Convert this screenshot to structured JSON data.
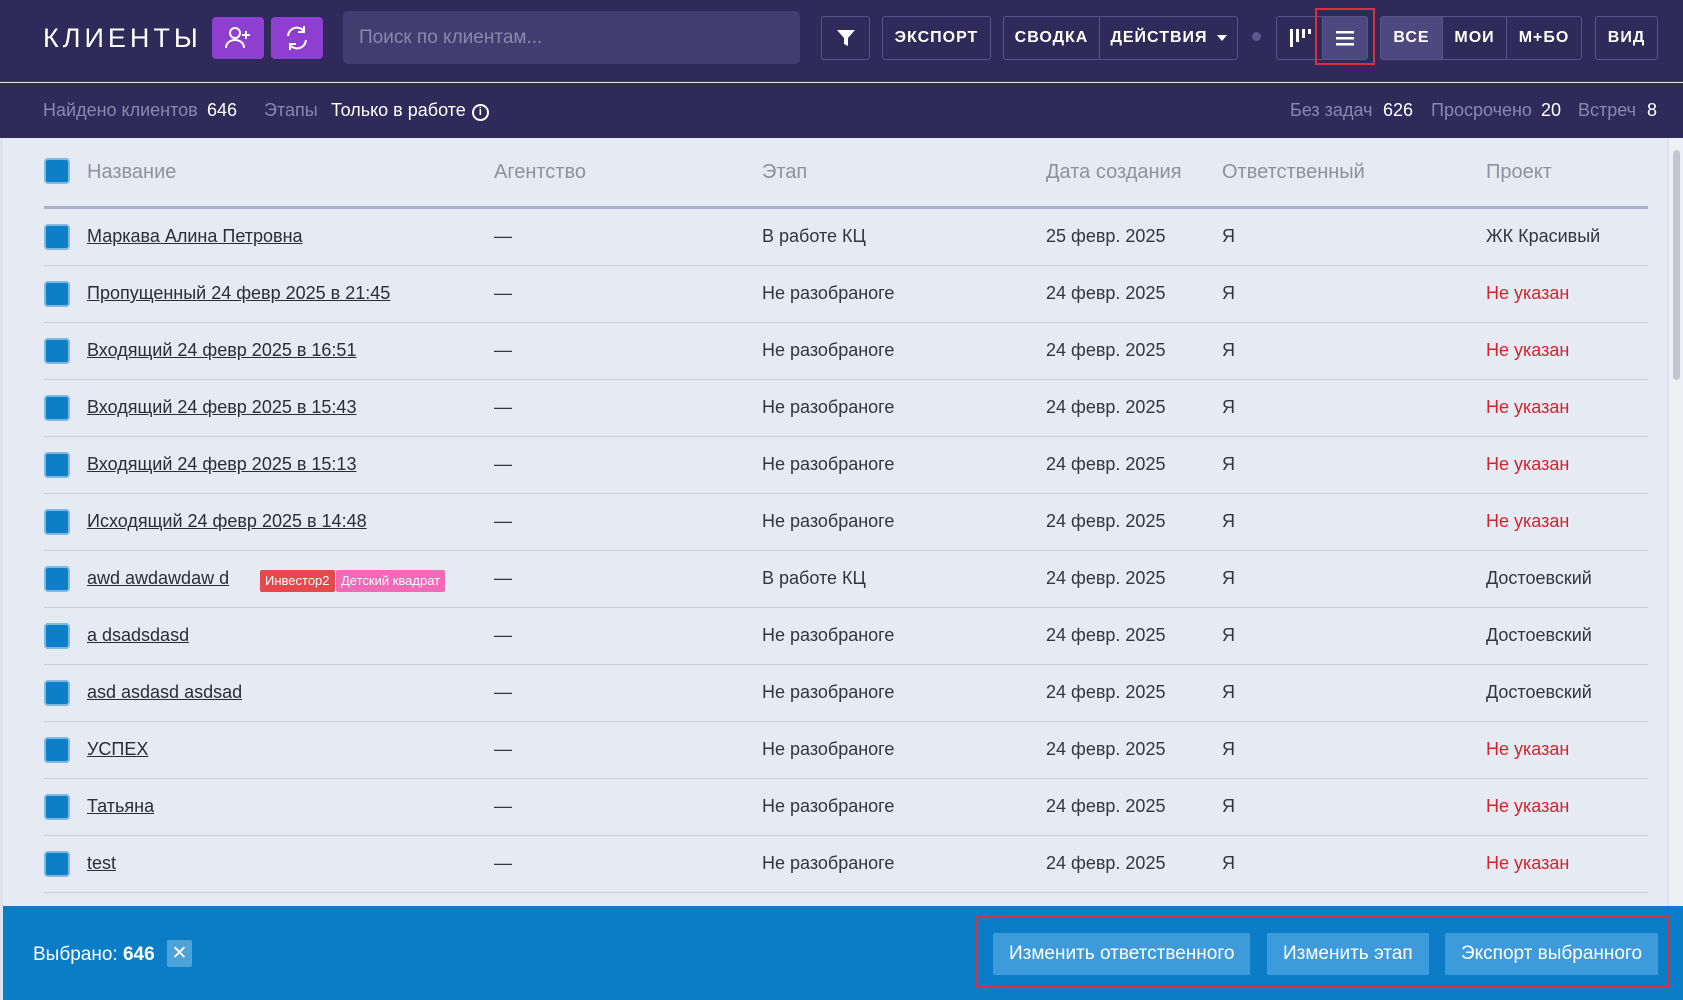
{
  "header": {
    "title": "КЛИЕНТЫ",
    "search_placeholder": "Поиск по клиентам...",
    "export_label": "ЭКСПОРТ",
    "summary_label": "СВОДКА",
    "actions_label": "ДЕЙСТВИЯ",
    "filter_all": "ВСЕ",
    "filter_mine": "МОИ",
    "filter_mine_plus": "М+БО",
    "view_label": "ВИД",
    "icons": [
      "add-user-icon",
      "refresh-icon",
      "filter-icon",
      "kanban-icon",
      "list-icon",
      "caret-down-icon"
    ],
    "accent_color": "#8f3fcf"
  },
  "subheader": {
    "found_label": "Найдено клиентов",
    "found_count": "646",
    "stages_label": "Этапы",
    "stages_value": "Только в работе",
    "no_tasks_label": "Без задач",
    "no_tasks_count": "626",
    "overdue_label": "Просрочено",
    "overdue_count": "20",
    "meetings_label": "Встреч",
    "meetings_count": "8"
  },
  "table": {
    "columns": [
      "Название",
      "Агентство",
      "Этап",
      "Дата создания",
      "Ответственный",
      "Проект"
    ],
    "rows": [
      {
        "name": "Маркава Алина Петровна",
        "agency": "—",
        "stage": "В работе КЦ",
        "date": "25 февр. 2025",
        "responsible": "Я",
        "project": "ЖК Красивый",
        "project_missing": false,
        "tags": []
      },
      {
        "name": "Пропущенный 24 февр 2025 в 21:45",
        "agency": "—",
        "stage": "Не разобраноге",
        "date": "24 февр. 2025",
        "responsible": "Я",
        "project": "Не указан",
        "project_missing": true,
        "tags": []
      },
      {
        "name": "Входящий 24 февр 2025 в 16:51",
        "agency": "—",
        "stage": "Не разобраноге",
        "date": "24 февр. 2025",
        "responsible": "Я",
        "project": "Не указан",
        "project_missing": true,
        "tags": []
      },
      {
        "name": "Входящий 24 февр 2025 в 15:43",
        "agency": "—",
        "stage": "Не разобраноге",
        "date": "24 февр. 2025",
        "responsible": "Я",
        "project": "Не указан",
        "project_missing": true,
        "tags": []
      },
      {
        "name": "Входящий 24 февр 2025 в 15:13",
        "agency": "—",
        "stage": "Не разобраноге",
        "date": "24 февр. 2025",
        "responsible": "Я",
        "project": "Не указан",
        "project_missing": true,
        "tags": []
      },
      {
        "name": "Исходящий 24 февр 2025 в 14:48",
        "agency": "—",
        "stage": "Не разобраноге",
        "date": "24 февр. 2025",
        "responsible": "Я",
        "project": "Не указан",
        "project_missing": true,
        "tags": []
      },
      {
        "name": "awd awdawdaw d",
        "agency": "—",
        "stage": "В работе КЦ",
        "date": "24 февр. 2025",
        "responsible": "Я",
        "project": "Достоевский",
        "project_missing": false,
        "tags": [
          {
            "label": "Инвестор2",
            "color": "#e5484d"
          },
          {
            "label": "Детский квадрат",
            "color": "#f06ab8"
          }
        ]
      },
      {
        "name": "a dsadsdasd",
        "agency": "—",
        "stage": "Не разобраноге",
        "date": "24 февр. 2025",
        "responsible": "Я",
        "project": "Достоевский",
        "project_missing": false,
        "tags": []
      },
      {
        "name": "asd asdasd asdsad",
        "agency": "—",
        "stage": "Не разобраноге",
        "date": "24 февр. 2025",
        "responsible": "Я",
        "project": "Достоевский",
        "project_missing": false,
        "tags": []
      },
      {
        "name": "УСПЕХ",
        "agency": "—",
        "stage": "Не разобраноге",
        "date": "24 февр. 2025",
        "responsible": "Я",
        "project": "Не указан",
        "project_missing": true,
        "tags": []
      },
      {
        "name": "Татьяна",
        "agency": "—",
        "stage": "Не разобраноге",
        "date": "24 февр. 2025",
        "responsible": "Я",
        "project": "Не указан",
        "project_missing": true,
        "tags": []
      },
      {
        "name": "test",
        "agency": "—",
        "stage": "Не разобраноге",
        "date": "24 февр. 2025",
        "responsible": "Я",
        "project": "Не указан",
        "project_missing": true,
        "tags": []
      }
    ]
  },
  "footer": {
    "selected_label": "Выбрано:",
    "selected_count": "646",
    "change_responsible": "Изменить ответственного",
    "change_stage": "Изменить этап",
    "export_selected": "Экспорт выбранного",
    "bar_color": "#0a7dc6"
  }
}
